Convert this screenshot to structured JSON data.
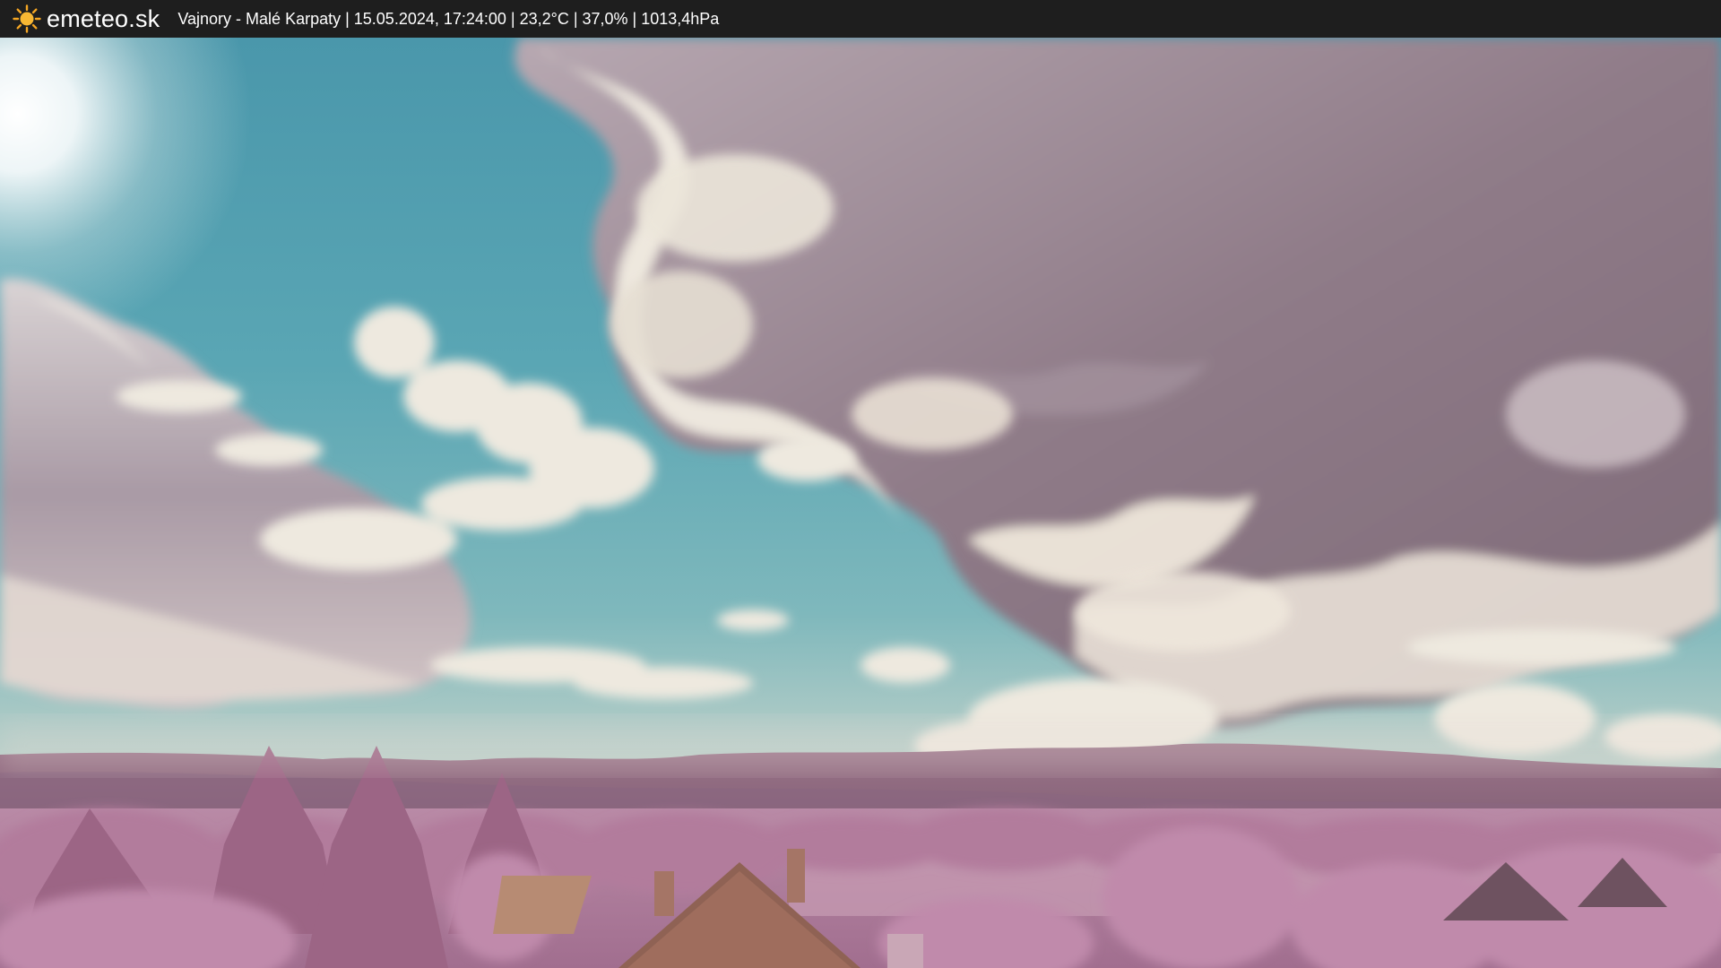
{
  "header": {
    "brand": "emeteo.sk",
    "caption": "Vajnory - Malé Karpaty | 15.05.2024, 17:24:00 | 23,2°C | 37,0% | 1013,4hPa",
    "logo_icon": "sun-icon"
  },
  "colors": {
    "bar": "#1e1e1e",
    "sun": "#f5a623",
    "sky_top": "#4f9db0",
    "sky_horizon": "#b9d0cc",
    "vegetation": "#b77fa0",
    "hills": "#8e6a82"
  }
}
